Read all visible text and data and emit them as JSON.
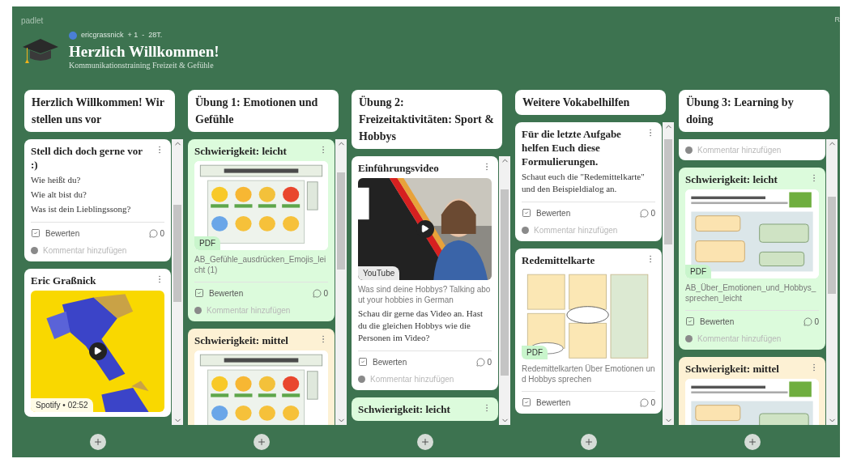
{
  "brand": "padlet",
  "edge_text": "R",
  "header": {
    "author": "ericgrassnick",
    "collaborators": "+ 1",
    "separator": "-",
    "age": "28T.",
    "title": "Herzlich Willkommen!",
    "subtitle": "Kommunikationstraining Freizeit & Gefühle"
  },
  "columns": [
    {
      "title": "Herzlich Willkommen! Wir stellen uns vor",
      "posts": [
        {
          "kind": "full",
          "color": "#ffffff",
          "title": "Stell dich doch gerne vor :)",
          "content": [
            {
              "kind": "text",
              "text": "Wie heißt du?"
            },
            {
              "kind": "text",
              "text": "Wie alt bist du?"
            },
            {
              "kind": "text",
              "text": "Was ist dein Lieblingssong?"
            }
          ],
          "rate_label": "Bewerten",
          "comment_count": "0",
          "comment_placeholder": "Kommentar hinzufügen"
        },
        {
          "kind": "full",
          "color": "#ffffff",
          "title": "Eric Graßnick",
          "content": [
            {
              "kind": "spotify",
              "label": "Spotify • 02:52"
            }
          ]
        }
      ]
    },
    {
      "title": "Übung 1: Emotionen und Gefühle",
      "posts": [
        {
          "kind": "full",
          "color": "#dcfbdc",
          "title": "Schwierigkeit: leicht",
          "content": [
            {
              "kind": "pdf",
              "label": "PDF",
              "caption": "AB_Gefühle_ausdrücken_Emojis_leicht (1)"
            }
          ],
          "rate_label": "Bewerten",
          "comment_count": "0",
          "comment_placeholder": "Kommentar hinzufügen"
        },
        {
          "kind": "full",
          "color": "#fdf1d4",
          "title": "Schwierigkeit: mittel",
          "content": [
            {
              "kind": "pdf"
            }
          ]
        }
      ]
    },
    {
      "title": "Übung 2: Freizeitaktivitäten: Sport & Hobbys",
      "posts": [
        {
          "kind": "full",
          "color": "#ffffff",
          "title": "Einführungsvideo",
          "content": [
            {
              "kind": "youtube",
              "label": "YouTube",
              "caption": "Was sind deine Hobbys? Talking about your hobbies in German"
            },
            {
              "kind": "text",
              "text": "Schau dir gerne das Video an. Hast du die gleichen Hobbys wie die Personen im Video?"
            }
          ],
          "rate_label": "Bewerten",
          "comment_count": "0",
          "comment_placeholder": "Kommentar hinzufügen"
        },
        {
          "kind": "full",
          "color": "#dcfbdc",
          "title": "Schwierigkeit: leicht"
        }
      ]
    },
    {
      "title": "Weitere Vokabelhilfen",
      "posts": [
        {
          "kind": "full",
          "color": "#ffffff",
          "title": "Für die letzte Aufgabe helfen Euch diese Formulierungen.",
          "content": [
            {
              "kind": "text",
              "text": "Schaut euch die \"Redemittelkarte\" und den Beispieldialog an."
            }
          ],
          "rate_label": "Bewerten",
          "comment_count": "0",
          "comment_placeholder": "Kommentar hinzufügen"
        },
        {
          "kind": "full",
          "color": "#ffffff",
          "title": "Redemittelkarte",
          "content": [
            {
              "kind": "pdf",
              "label": "PDF",
              "caption": "Redemittelkarten Über Emotionen und Hobbys sprechen"
            }
          ],
          "rate_label": "Bewerten",
          "comment_count": "0"
        }
      ]
    },
    {
      "title": "Übung 3: Learning by doing",
      "posts": [
        {
          "kind": "partial",
          "color": "#ffffff",
          "comment_placeholder": "Kommentar hinzufügen"
        },
        {
          "kind": "full",
          "color": "#dcfbdc",
          "title": "Schwierigkeit: leicht",
          "content": [
            {
              "kind": "pdf",
              "label": "PDF",
              "caption": "AB_Über_Emotionen_und_Hobbys_sprechen_leicht"
            }
          ],
          "rate_label": "Bewerten",
          "comment_count": "0",
          "comment_placeholder": "Kommentar hinzufügen"
        },
        {
          "kind": "full",
          "color": "#fdf1d4",
          "title": "Schwierigkeit: mittel",
          "content": [
            {
              "kind": "pdf"
            }
          ]
        }
      ]
    }
  ]
}
